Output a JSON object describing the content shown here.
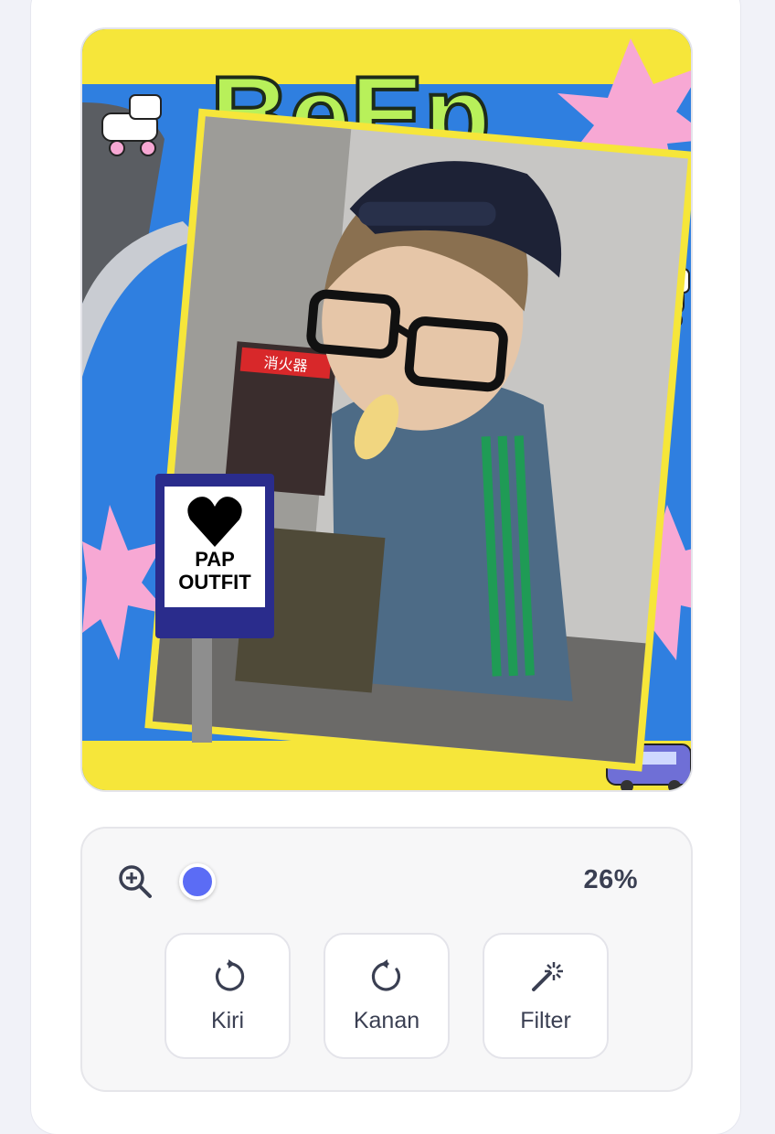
{
  "photo_frame": {
    "sign_line1": "PAP",
    "sign_line2": "OUTFIT",
    "sticker_text": "BeEp",
    "wall_sign": "消火器",
    "colors": {
      "yellow": "#f6e63a",
      "blue": "#2f7fe0",
      "pink": "#f7a8d4",
      "green": "#b8f05a"
    }
  },
  "controls": {
    "zoom_icon": "zoom-in-icon",
    "zoom_value": "26%",
    "zoom_fraction": 0.26,
    "buttons": [
      {
        "label": "Kiri",
        "icon": "rotate-left-icon"
      },
      {
        "label": "Kanan",
        "icon": "rotate-right-icon"
      },
      {
        "label": "Filter",
        "icon": "magic-wand-icon"
      }
    ],
    "accent": "#5b6cf5"
  }
}
